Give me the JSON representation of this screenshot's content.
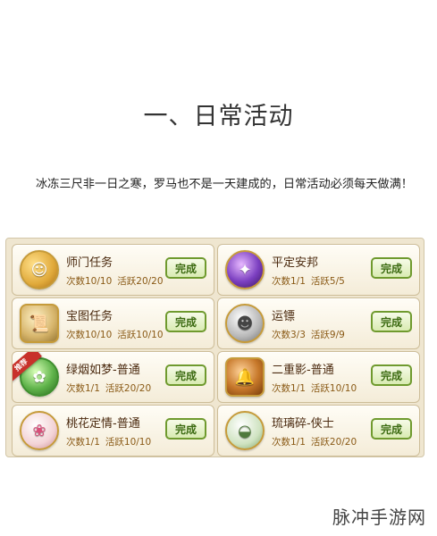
{
  "article": {
    "title": "一、日常活动",
    "intro": "冰冻三尺非一日之寒，罗马也不是一天建成的，日常活动必须每天做满！"
  },
  "activities": [
    {
      "name": "师门任务",
      "count": "次数10/10",
      "active": "活跃20/20",
      "button": "完成",
      "icon": "gold-coin-icon",
      "icon_color": "#e0a93a"
    },
    {
      "name": "平定安邦",
      "count": "次数1/1",
      "active": "活跃5/5",
      "button": "完成",
      "icon": "purple-gem-icon",
      "icon_color": "#6a3aa8"
    },
    {
      "name": "宝图任务",
      "count": "次数10/10",
      "active": "活跃10/10",
      "button": "完成",
      "icon": "scroll-icon",
      "icon_color": "#d6b46a"
    },
    {
      "name": "运镖",
      "count": "次数3/3",
      "active": "活跃9/9",
      "button": "完成",
      "icon": "silver-coin-icon",
      "icon_color": "#9a9a9a"
    },
    {
      "name": "绿烟如梦-普通",
      "count": "次数1/1",
      "active": "活跃20/20",
      "button": "完成",
      "icon": "green-orb-icon",
      "icon_color": "#5fb34a",
      "badge": "推荐"
    },
    {
      "name": "二重影-普通",
      "count": "次数1/1",
      "active": "活跃10/10",
      "button": "完成",
      "icon": "bell-icon",
      "icon_color": "#c7782a"
    },
    {
      "name": "桃花定情-普通",
      "count": "次数1/1",
      "active": "活跃10/10",
      "button": "完成",
      "icon": "peach-blossom-icon",
      "icon_color": "#f3d3d6"
    },
    {
      "name": "琉璃碎-侠士",
      "count": "次数1/1",
      "active": "活跃20/20",
      "button": "完成",
      "icon": "jade-bowl-icon",
      "icon_color": "#cfe3c1"
    }
  ],
  "watermark": "脉冲手游网"
}
